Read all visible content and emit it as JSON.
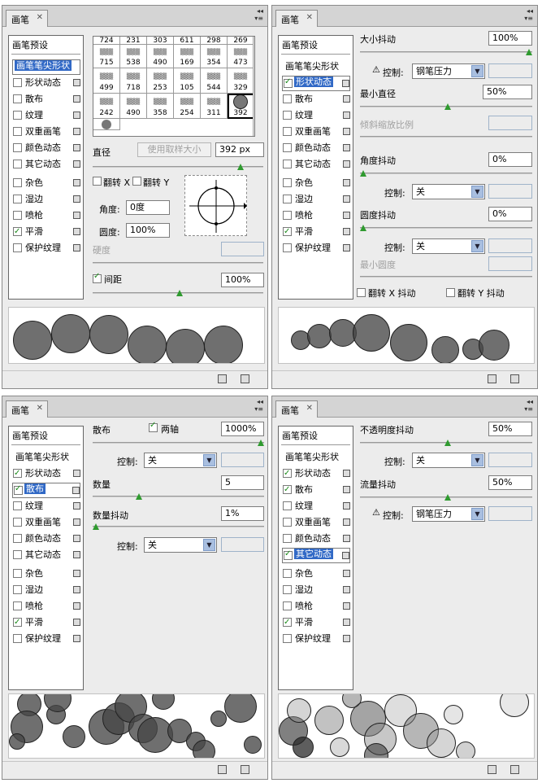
{
  "panel_title": "画笔",
  "preset_header": "画笔预设",
  "list_items": [
    "画笔笔尖形状",
    "形状动态",
    "散布",
    "纹理",
    "双重画笔",
    "颜色动态",
    "其它动态",
    "杂色",
    "湿边",
    "喷枪",
    "平滑",
    "保护纹理"
  ],
  "panels": [
    {
      "selected": 0,
      "checked": [
        false,
        false,
        false,
        false,
        false,
        false,
        false,
        false,
        false,
        true,
        false
      ],
      "brush_grid": [
        [
          "724",
          "231",
          "303",
          "611",
          "298",
          "269"
        ],
        [
          "715",
          "538",
          "490",
          "169",
          "354",
          "473"
        ],
        [
          "499",
          "718",
          "253",
          "105",
          "544",
          "329"
        ],
        [
          "242",
          "490",
          "358",
          "254",
          "311",
          "392"
        ]
      ],
      "diameter_label": "直径",
      "use_sample_btn": "使用取样大小",
      "diameter_value": "392 px",
      "flip_x": "翻转 X",
      "flip_y": "翻转 Y",
      "angle_label": "角度:",
      "angle_value": "0度",
      "roundness_label": "圆度:",
      "roundness_value": "100%",
      "hardness_label": "硬度",
      "spacing_label": "间距",
      "spacing_value": "100%"
    },
    {
      "selected": 1,
      "checked": [
        true,
        false,
        false,
        false,
        false,
        false,
        false,
        false,
        false,
        true,
        false
      ],
      "size_jitter_label": "大小抖动",
      "size_jitter_value": "100%",
      "control_label": "控制:",
      "control1": "钢笔压力",
      "min_diameter_label": "最小直径",
      "min_diameter_value": "50%",
      "tilt_label": "倾斜缩放比例",
      "angle_jitter_label": "角度抖动",
      "angle_jitter_value": "0%",
      "control2": "关",
      "round_jitter_label": "圆度抖动",
      "round_jitter_value": "0%",
      "control3": "关",
      "min_round_label": "最小圆度",
      "flip_x_jitter": "翻转 X 抖动",
      "flip_y_jitter": "翻转 Y 抖动"
    },
    {
      "selected": 2,
      "checked": [
        true,
        true,
        false,
        false,
        false,
        false,
        false,
        false,
        false,
        true,
        false
      ],
      "scatter_label": "散布",
      "both_axes": "两轴",
      "scatter_value": "1000%",
      "control_label": "控制:",
      "control1": "关",
      "count_label": "数量",
      "count_value": "5",
      "count_jitter_label": "数量抖动",
      "count_jitter_value": "1%",
      "control2": "关"
    },
    {
      "selected": 6,
      "checked": [
        true,
        true,
        false,
        false,
        false,
        true,
        false,
        false,
        false,
        true,
        false
      ],
      "opacity_label": "不透明度抖动",
      "opacity_value": "50%",
      "control_label": "控制:",
      "control1": "关",
      "flow_label": "流量抖动",
      "flow_value": "50%",
      "control2": "钢笔压力"
    }
  ]
}
